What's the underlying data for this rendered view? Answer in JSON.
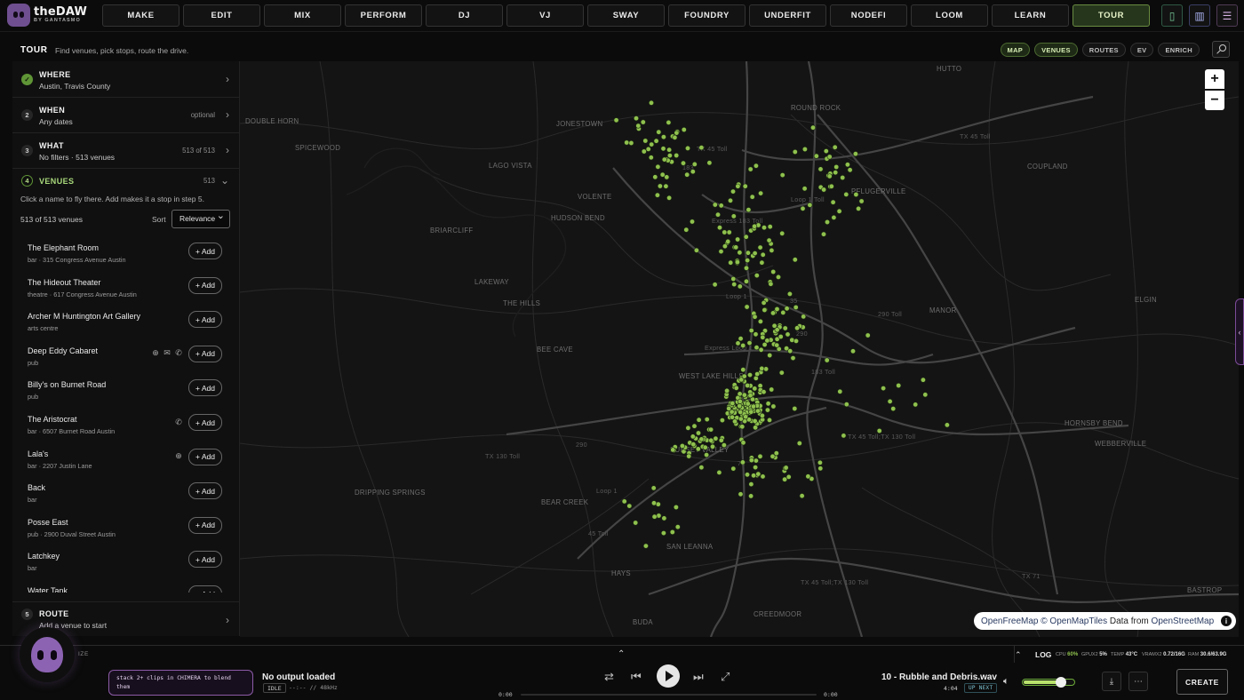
{
  "app": {
    "name": "theDAW",
    "subtitle": "BY GANTASMO"
  },
  "nav": {
    "tabs": [
      "MAKE",
      "EDIT",
      "MIX",
      "PERFORM",
      "DJ",
      "VJ",
      "SWAY",
      "FOUNDRY",
      "UNDERFIT",
      "NODEFI",
      "LOOM",
      "LEARN",
      "TOUR"
    ],
    "active": "TOUR",
    "right_icons": [
      "phone-icon",
      "book-icon",
      "menu-icon"
    ]
  },
  "tour": {
    "title": "TOUR",
    "subtitle": "Find venues, pick stops, route the drive.",
    "pills": [
      {
        "label": "MAP",
        "active": true
      },
      {
        "label": "VENUES",
        "active": true
      },
      {
        "label": "ROUTES",
        "active": false
      },
      {
        "label": "EV",
        "active": false
      },
      {
        "label": "ENRICH",
        "active": false
      }
    ]
  },
  "steps": {
    "where": {
      "num": "1",
      "label": "WHERE",
      "value": "Austin, Travis County"
    },
    "when": {
      "num": "2",
      "label": "WHEN",
      "value": "Any dates",
      "meta": "optional"
    },
    "what": {
      "num": "3",
      "label": "WHAT",
      "value": "No filters · 513 venues",
      "meta": "513 of 513"
    },
    "venues": {
      "num": "4",
      "label": "VENUES",
      "meta": "513"
    },
    "route": {
      "num": "5",
      "label": "ROUTE",
      "value": "Add a venue to start"
    }
  },
  "venues_panel": {
    "hint": "Click a name to fly there. Add makes it a stop in step 5.",
    "count": "513 of 513 venues",
    "sort_label": "Sort",
    "sort_value": "Relevance",
    "add_label": "+ Add",
    "items": [
      {
        "name": "The Elephant Room",
        "meta": "bar · 315 Congress Avenue Austin",
        "icons": []
      },
      {
        "name": "The Hideout Theater",
        "meta": "theatre · 617 Congress Avenue Austin",
        "icons": []
      },
      {
        "name": "Archer M Huntington Art Gallery",
        "meta": "arts centre",
        "icons": []
      },
      {
        "name": "Deep Eddy Cabaret",
        "meta": "pub",
        "icons": [
          "globe-icon",
          "mail-icon",
          "phone-icon"
        ]
      },
      {
        "name": "Billy's on Burnet Road",
        "meta": "pub",
        "icons": []
      },
      {
        "name": "The Aristocrat",
        "meta": "bar · 6507 Burnet Road Austin",
        "icons": [
          "phone-icon"
        ]
      },
      {
        "name": "Lala's",
        "meta": "bar · 2207 Justin Lane",
        "icons": [
          "globe-icon"
        ]
      },
      {
        "name": "Back",
        "meta": "bar",
        "icons": []
      },
      {
        "name": "Posse East",
        "meta": "pub · 2900 Duval Street Austin",
        "icons": []
      },
      {
        "name": "Latchkey",
        "meta": "bar",
        "icons": []
      },
      {
        "name": "Water Tank",
        "meta": "",
        "icons": []
      }
    ]
  },
  "map": {
    "places": [
      "HUTTO",
      "DOUBLE HORN",
      "JONESTOWN",
      "ROUND ROCK",
      "SPICEWOOD",
      "LAGO VISTA",
      "COUPLAND",
      "PFLUGERVILLE",
      "VOLENTE",
      "HUDSON BEND",
      "BRIARCLIFF",
      "LAKEWAY",
      "THE HILLS",
      "MANOR",
      "ELGIN",
      "BEE CAVE",
      "WEST LAKE HILLS",
      "HORNSBY BEND",
      "WEBBERVILLE",
      "SUNSET VALLEY",
      "DRIPPING SPRINGS",
      "BEAR CREEK",
      "SAN LEANNA",
      "HAYS",
      "CREEDMOOR",
      "BUDA",
      "BASTROP"
    ],
    "road_labels": [
      "TX 45 Toll",
      "183",
      "Loop 1 Toll",
      "Express 183 Toll",
      "Loop 1",
      "35",
      "290 Toll",
      "Express Loop 1",
      "290",
      "183 Toll",
      "TX 45 Toll;TX 130 Toll",
      "71",
      "290",
      "Loop 1",
      "45 Toll",
      "TX 45 Toll;TX 130 Toll",
      "TX 45 Toll",
      "TX 130 Toll",
      "TX 71"
    ],
    "zoom_in": "+",
    "zoom_out": "−",
    "attribution": {
      "a": "OpenFreeMap",
      "b": "© OpenMapTiles",
      "c": "Data from",
      "d": "OpenStreetMap"
    },
    "marker_color": "#8fc14e"
  },
  "log": {
    "label": "LOG",
    "cpu_label": "CPU",
    "cpu": "60%",
    "gpu_label": "GPUX2",
    "gpu": "5%",
    "temp_label": "TEMP",
    "temp": "43°C",
    "vram_label": "VRAMX2",
    "vram": "0.72/16G",
    "ram_label": "RAM",
    "ram": "30.6/63.9G",
    "left_tag": "IZE"
  },
  "transport": {
    "hint": "stack 2+ clips in CHIMERA to blend them",
    "output_title": "No output loaded",
    "state": "IDLE",
    "rate": "--:-- // 48kHz",
    "elapsed": "0:00",
    "total": "0:00",
    "track": "10 - Rubble and Debris.wav",
    "duration": "4:04",
    "up_next": "UP NEXT",
    "volume": 0.7,
    "create": "CREATE"
  }
}
